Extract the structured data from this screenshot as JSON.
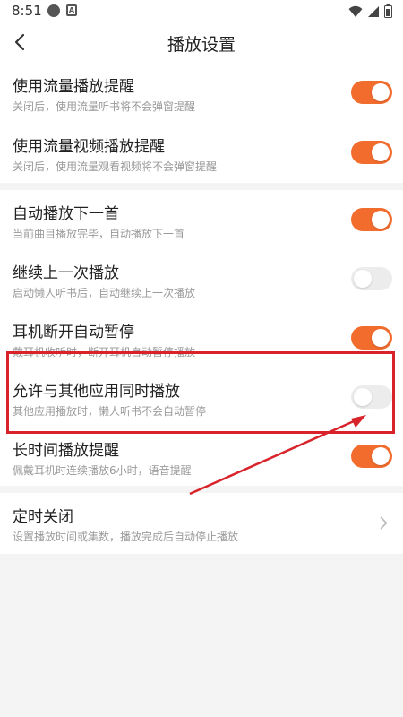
{
  "status_bar": {
    "time": "8:51",
    "notif_glyph": "A"
  },
  "header": {
    "title": "播放设置"
  },
  "section1": [
    {
      "title": "使用流量播放提醒",
      "subtitle": "关闭后，使用流量听书将不会弹窗提醒",
      "enabled": true
    },
    {
      "title": "使用流量视频播放提醒",
      "subtitle": "关闭后，使用流量观看视频将不会弹窗提醒",
      "enabled": true
    }
  ],
  "section2": [
    {
      "title": "自动播放下一首",
      "subtitle": "当前曲目播放完毕，自动播放下一首",
      "enabled": true
    },
    {
      "title": "继续上一次播放",
      "subtitle": "启动懒人听书后，自动继续上一次播放",
      "enabled": false
    },
    {
      "title": "耳机断开自动暂停",
      "subtitle": "戴耳机收听时，断开耳机自动暂停播放",
      "enabled": true
    },
    {
      "title": "允许与其他应用同时播放",
      "subtitle": "其他应用播放时，懒人听书不会自动暂停",
      "enabled": false
    },
    {
      "title": "长时间播放提醒",
      "subtitle": "佩戴耳机时连续播放6小时，语音提醒",
      "enabled": true
    }
  ],
  "section3": [
    {
      "title": "定时关闭",
      "subtitle": "设置播放时间或集数，播放完成后自动停止播放"
    }
  ],
  "colors": {
    "accent": "#f26c2e",
    "toggle_off": "#ececec",
    "annotation": "#d8232a"
  },
  "icons": {
    "back": "chevron-left-icon",
    "chevron": "chevron-right-icon"
  }
}
